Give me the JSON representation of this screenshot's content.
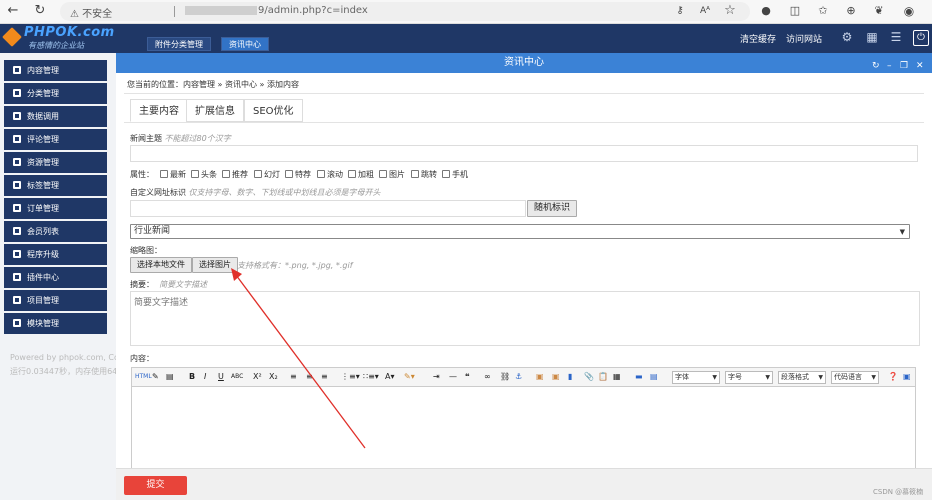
{
  "browser": {
    "security": "不安全",
    "url_suffix": "9/admin.php?c=index",
    "icons": [
      "back-icon",
      "refresh-icon",
      "home-icon",
      "key-icon",
      "read-aloud-icon",
      "star-icon",
      "extension-icon",
      "split-icon",
      "favorites-icon",
      "collections-icon",
      "profile-icon"
    ]
  },
  "header": {
    "brand": "PHPOK.com",
    "slogan": "有感情的企业站",
    "tabs": [
      "附件分类管理",
      "资讯中心"
    ],
    "active_tab": 1,
    "clear_cache": "清空缓存",
    "visit_site": "访问网站",
    "logout_symbol": "⏻",
    "colors": {
      "nav": "#1f3766",
      "accent": "#3b82d6",
      "submit": "#e8443a"
    }
  },
  "sidebar": {
    "items": [
      "内容管理",
      "分类管理",
      "数据调用",
      "评论管理",
      "资源管理",
      "标签管理",
      "订单管理",
      "会员列表",
      "程序升级",
      "插件中心",
      "项目管理",
      "模块管理"
    ],
    "powered_line1": "Powered by phpok.com, Co",
    "powered_line2": "运行0.03447秒，内存使用64"
  },
  "panel": {
    "title": "资讯中心",
    "breadcrumb": "您当前的位置：内容管理 » 资讯中心 » 添加内容",
    "tabs": [
      "主要内容",
      "扩展信息",
      "SEO优化"
    ],
    "active_tab": 0
  },
  "form": {
    "title_label": "新闻主题",
    "title_hint": "不能超过80个汉字",
    "attr_label": "属性：",
    "attributes": [
      "最新",
      "头条",
      "推荐",
      "幻灯",
      "特荐",
      "滚动",
      "加粗",
      "图片",
      "跳转",
      "手机"
    ],
    "slug_label": "自定义网址标识",
    "slug_hint": "仅支持字母、数字、下划线或中划线且必须是字母开头",
    "random_button": "随机标识",
    "category_value": "行业新闻",
    "thumb_label": "缩略图：",
    "local_file_button": "选择本地文件",
    "choose_image_button": "选择图片",
    "thumb_hint": "支持格式有：*.png, *.jpg, *.gif",
    "summary_label": "摘要：",
    "summary_hint": "简要文字描述",
    "summary_placeholder": "简要文字描述",
    "content_label": "内容：",
    "toolbar": {
      "font": "字体",
      "size": "字号",
      "paragraph": "段落格式",
      "code": "代码语言"
    },
    "submit": "提交"
  },
  "watermark": "CSDN @慕筱楠"
}
